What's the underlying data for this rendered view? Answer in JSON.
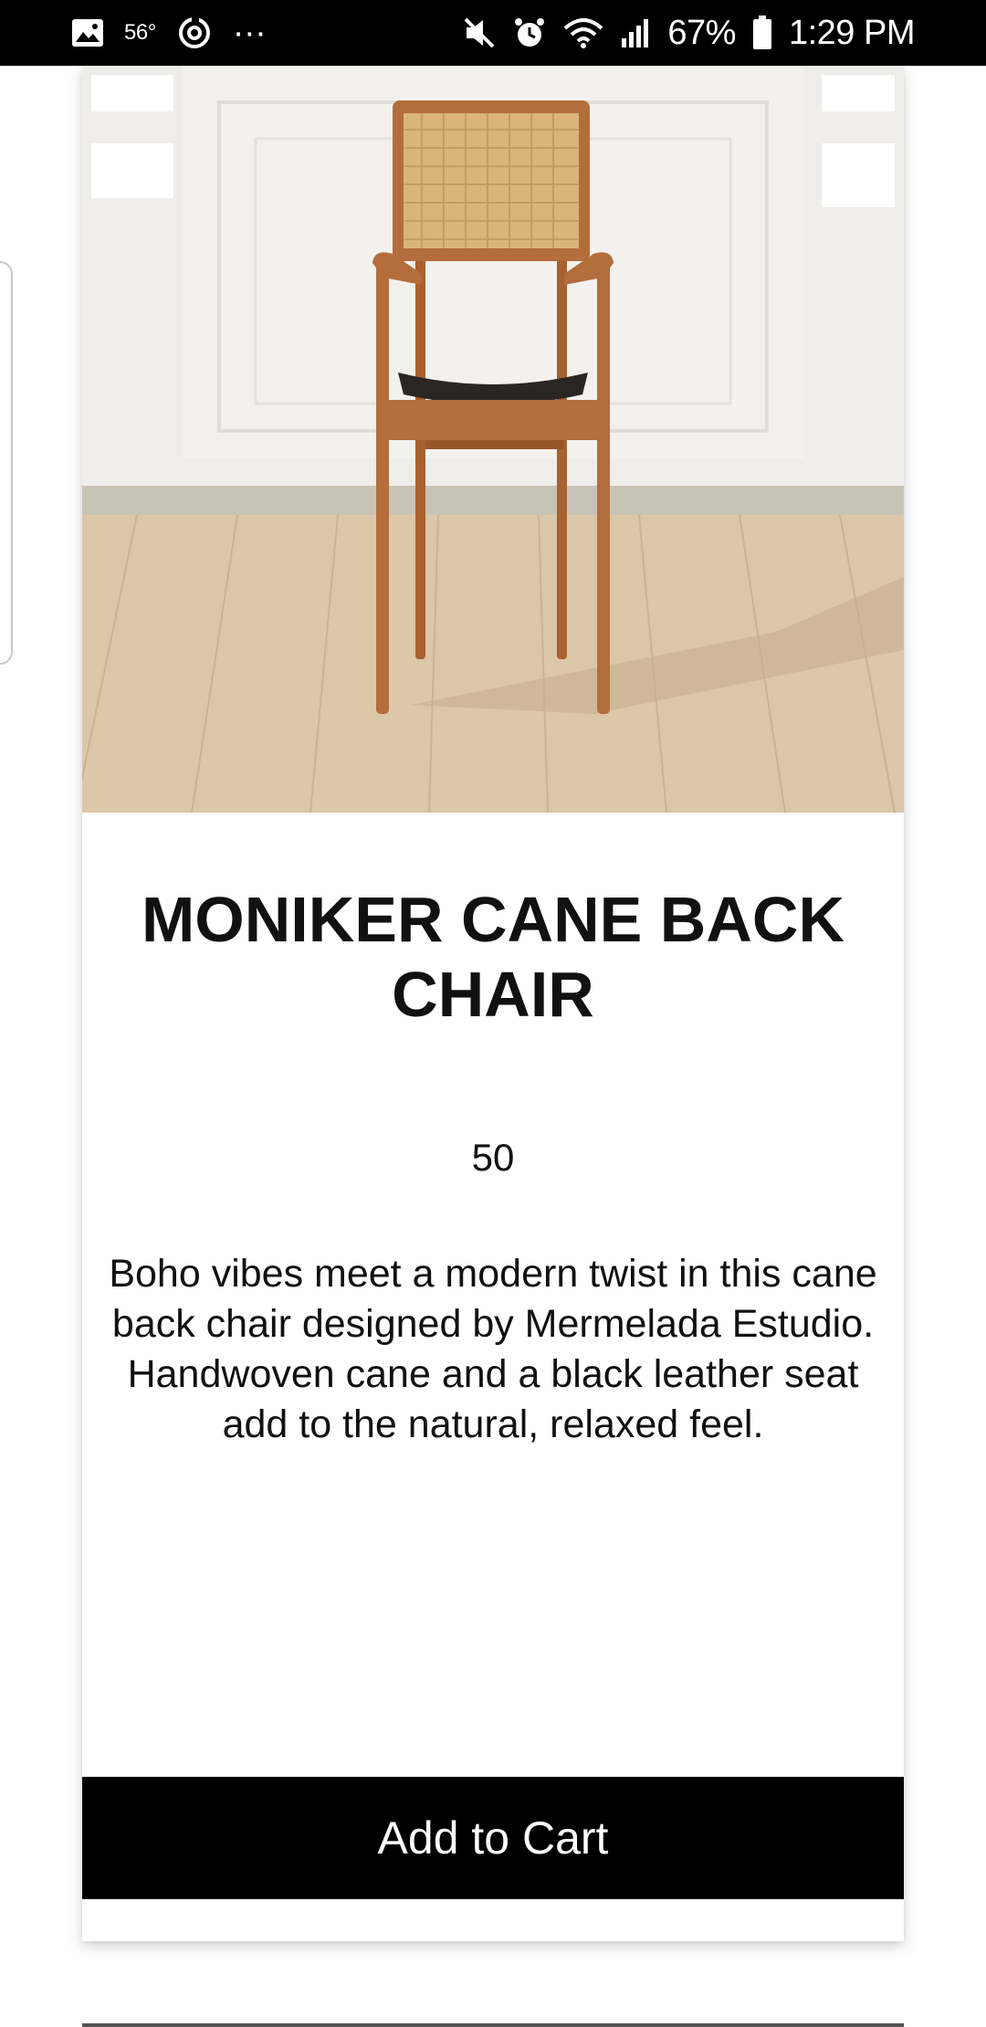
{
  "status_bar": {
    "temperature": "56°",
    "more": "···",
    "battery_percent": "67%",
    "time": "1:29 PM",
    "icons": [
      "image-icon",
      "refresh-icon",
      "mute-icon",
      "alarm-icon",
      "wifi-icon",
      "signal-icon",
      "battery-icon"
    ]
  },
  "product": {
    "image_alt": "cane-back-chair-photo",
    "title": "MONIKER CANE BACK CHAIR",
    "price": "50",
    "description": "Boho vibes meet a modern twist in this cane back chair designed by Mermelada Estudio. Handwoven cane and a black leather seat add to the natural, relaxed feel.",
    "add_to_cart_label": "Add to Cart"
  },
  "colors": {
    "status_bar_bg": "#000000",
    "button_bg": "#000000",
    "button_text": "#ffffff",
    "chair_wood": "#b46d3c",
    "cane": "#d9b57a",
    "floor": "#dcc7a8"
  }
}
